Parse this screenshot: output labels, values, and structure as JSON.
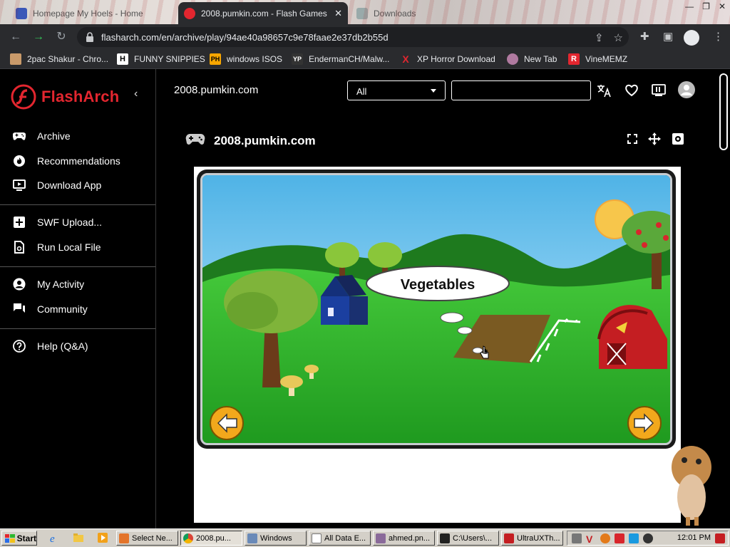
{
  "browser": {
    "tabs": [
      {
        "title": "Homepage My Hoels - Home",
        "active": false
      },
      {
        "title": "2008.pumkin.com - Flash Games",
        "active": true
      },
      {
        "title": "Downloads",
        "active": false
      }
    ],
    "url": "flasharch.com/en/archive/play/94ae40a98657c9e78faae2e37db2b55d",
    "bookmarks": [
      {
        "label": "2pac Shakur - Chro...",
        "icon_text": ""
      },
      {
        "label": "FUNNY SNIPPIES",
        "icon_text": "H"
      },
      {
        "label": "windows ISOS",
        "icon_text": "PH"
      },
      {
        "label": "EndermanCH/Malw...",
        "icon_text": "YP"
      },
      {
        "label": "XP Horror Download",
        "icon_text": "X"
      },
      {
        "label": "New Tab",
        "icon_text": ""
      },
      {
        "label": "VineMEMZ",
        "icon_text": "R"
      }
    ]
  },
  "sidebar": {
    "logo_text": "FlashArch",
    "items": [
      {
        "label": "Archive",
        "icon": "gamepad-icon"
      },
      {
        "label": "Recommendations",
        "icon": "fire-icon"
      },
      {
        "label": "Download App",
        "icon": "monitor-icon"
      },
      {
        "label": "SWF Upload...",
        "icon": "plus-square-icon"
      },
      {
        "label": "Run Local File",
        "icon": "file-icon"
      },
      {
        "label": "My Activity",
        "icon": "user-circle-icon"
      },
      {
        "label": "Community",
        "icon": "chat-icon"
      },
      {
        "label": "Help (Q&A)",
        "icon": "help-icon"
      }
    ]
  },
  "header": {
    "site_title": "2008.pumkin.com",
    "filter_selected": "All",
    "search_value": ""
  },
  "game": {
    "title": "2008.pumkin.com",
    "scene_label": "Vegetables"
  },
  "taskbar": {
    "start_label": "Start",
    "tasks": [
      {
        "label": "Select Ne...",
        "active": false
      },
      {
        "label": "2008.pu...",
        "active": true
      },
      {
        "label": "Windows",
        "active": false
      },
      {
        "label": "All Data E...",
        "active": false
      },
      {
        "label": "ahmed.pn...",
        "active": false
      },
      {
        "label": "C:\\Users\\...",
        "active": false
      },
      {
        "label": "UltraUXTh...",
        "active": false
      }
    ],
    "clock": "12:01 PM"
  },
  "colors": {
    "brand_red": "#e3262f",
    "chrome_dark": "#2a2b2e",
    "grass_green": "#2bb52b",
    "sky_blue": "#6fc3ea"
  }
}
